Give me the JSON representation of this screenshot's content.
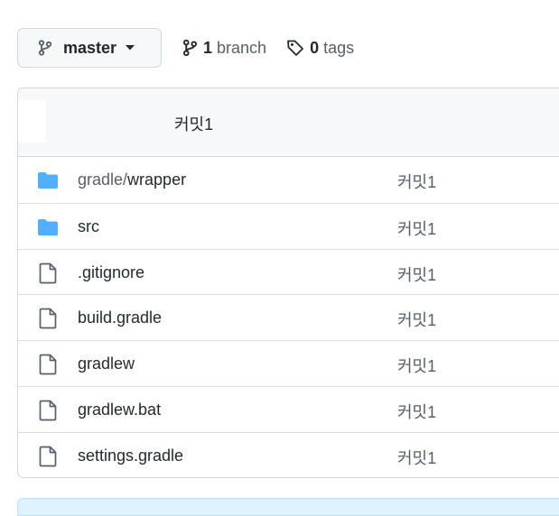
{
  "branch_selector": {
    "label": "master",
    "icon": "git-branch-icon"
  },
  "branches": {
    "count": "1",
    "label": "branch"
  },
  "tags": {
    "count": "0",
    "label": "tags"
  },
  "latest_commit": {
    "message": "커밋1"
  },
  "files": [
    {
      "type": "folder",
      "prefix": "gradle/",
      "name": "wrapper",
      "commit": "커밋1"
    },
    {
      "type": "folder",
      "prefix": "",
      "name": "src",
      "commit": "커밋1"
    },
    {
      "type": "file",
      "prefix": "",
      "name": ".gitignore",
      "commit": "커밋1"
    },
    {
      "type": "file",
      "prefix": "",
      "name": "build.gradle",
      "commit": "커밋1"
    },
    {
      "type": "file",
      "prefix": "",
      "name": "gradlew",
      "commit": "커밋1"
    },
    {
      "type": "file",
      "prefix": "",
      "name": "gradlew.bat",
      "commit": "커밋1"
    },
    {
      "type": "file",
      "prefix": "",
      "name": "settings.gradle",
      "commit": "커밋1"
    }
  ],
  "colors": {
    "folder": "#54aeff",
    "file_icon": "#57606a",
    "border": "#d0d7de",
    "readme_bar": "#ddf4ff"
  }
}
